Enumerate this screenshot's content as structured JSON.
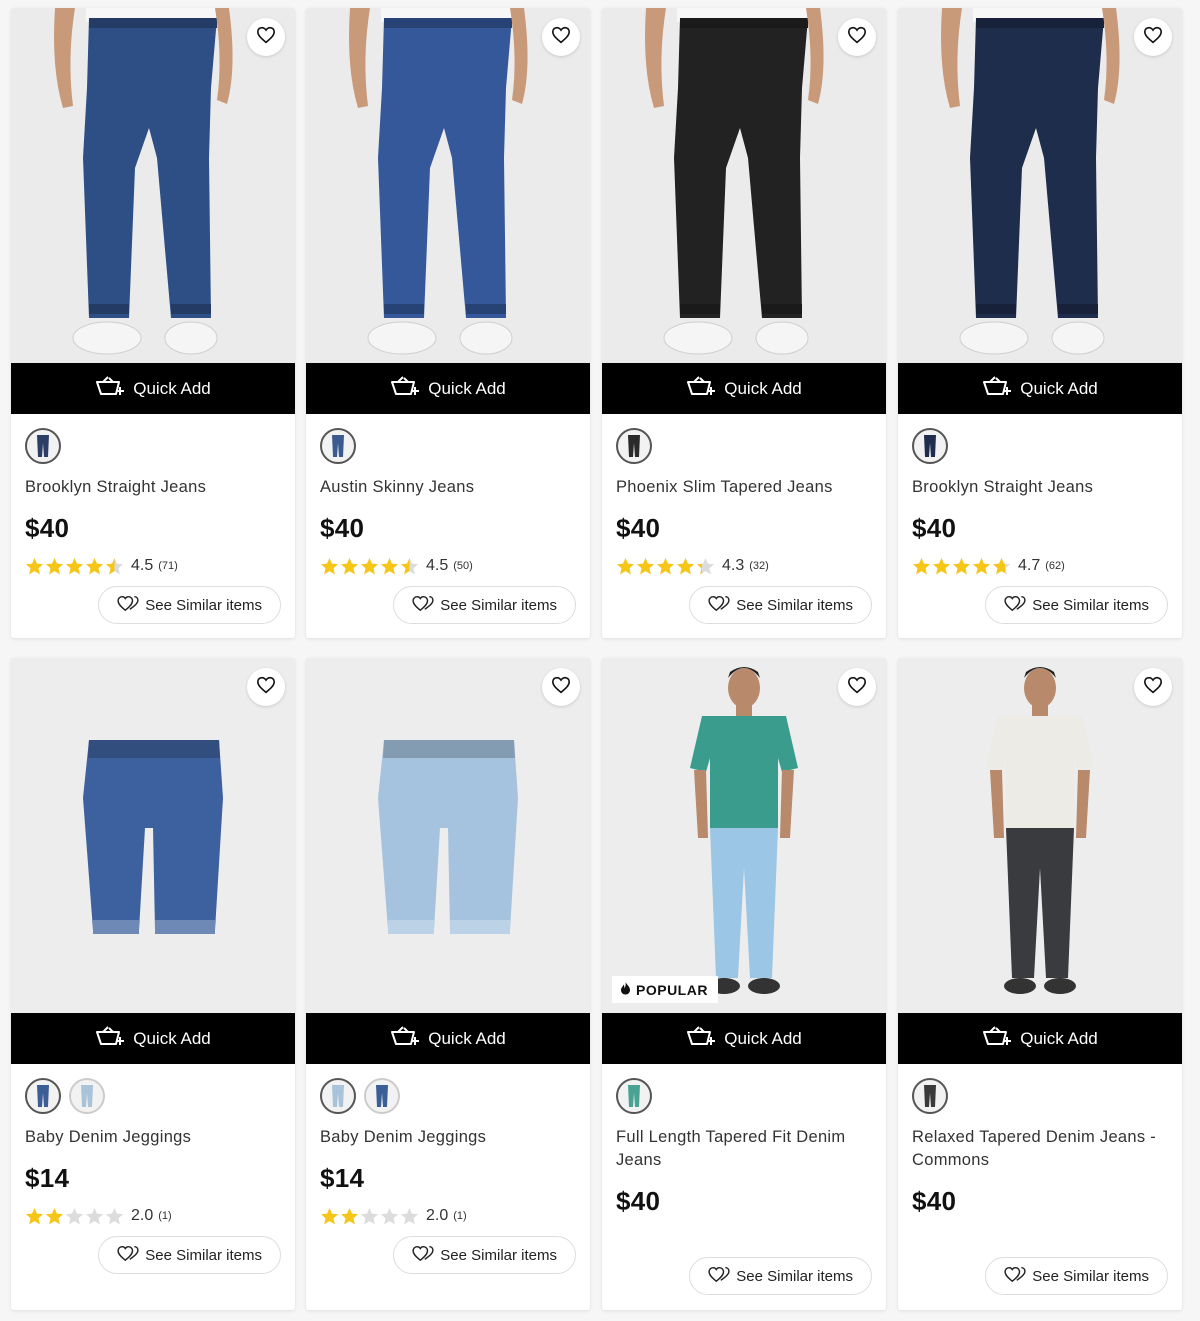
{
  "quick_add_label": "Quick Add",
  "see_similar_label": "See Similar items",
  "popular_label": "POPULAR",
  "colors": {
    "star": "#f5c518",
    "star_empty": "#dcdcdc",
    "button_bg": "#000000"
  },
  "products": [
    {
      "name": "Brooklyn Straight Jeans",
      "price": "$40",
      "rating": "4.5",
      "rating_value": 4.5,
      "count": "(71)",
      "swatches": [
        "#2a3e66"
      ],
      "jeans": "#2e4f86",
      "kind": "adult"
    },
    {
      "name": "Austin Skinny Jeans",
      "price": "$40",
      "rating": "4.5",
      "rating_value": 4.5,
      "count": "(50)",
      "swatches": [
        "#3a5a90"
      ],
      "jeans": "#34589a",
      "kind": "adult"
    },
    {
      "name": "Phoenix Slim Tapered Jeans",
      "price": "$40",
      "rating": "4.3",
      "rating_value": 4.3,
      "count": "(32)",
      "swatches": [
        "#2a2a2a"
      ],
      "jeans": "#222222",
      "kind": "adult"
    },
    {
      "name": "Brooklyn Straight Jeans",
      "price": "$40",
      "rating": "4.7",
      "rating_value": 4.7,
      "count": "(62)",
      "swatches": [
        "#1f2e4e"
      ],
      "jeans": "#1f2d4d",
      "kind": "adult"
    },
    {
      "name": "Baby Denim Jeggings",
      "price": "$14",
      "rating": "2.0",
      "rating_value": 2.0,
      "count": "(1)",
      "swatches": [
        "#3b5e96",
        "#a9c3d9"
      ],
      "jeans": "#3d619e",
      "kind": "baby"
    },
    {
      "name": "Baby Denim Jeggings",
      "price": "$14",
      "rating": "2.0",
      "rating_value": 2.0,
      "count": "(1)",
      "swatches": [
        "#a9c3d9",
        "#3b5e96"
      ],
      "jeans": "#a5c3de",
      "kind": "baby"
    },
    {
      "name": "Full Length Tapered Fit Denim Jeans",
      "price": "$40",
      "rating": "",
      "rating_value": null,
      "count": "",
      "swatches": [
        "#4aa293"
      ],
      "jeans": "#9cc6e6",
      "shirt": "#3a9c8c",
      "kind": "full",
      "popular": true
    },
    {
      "name": "Relaxed Tapered Denim Jeans - Commons",
      "price": "$40",
      "rating": "",
      "rating_value": null,
      "count": "",
      "swatches": [
        "#3a3a3a"
      ],
      "jeans": "#3a3b3e",
      "shirt": "#ecebe6",
      "kind": "full"
    }
  ]
}
